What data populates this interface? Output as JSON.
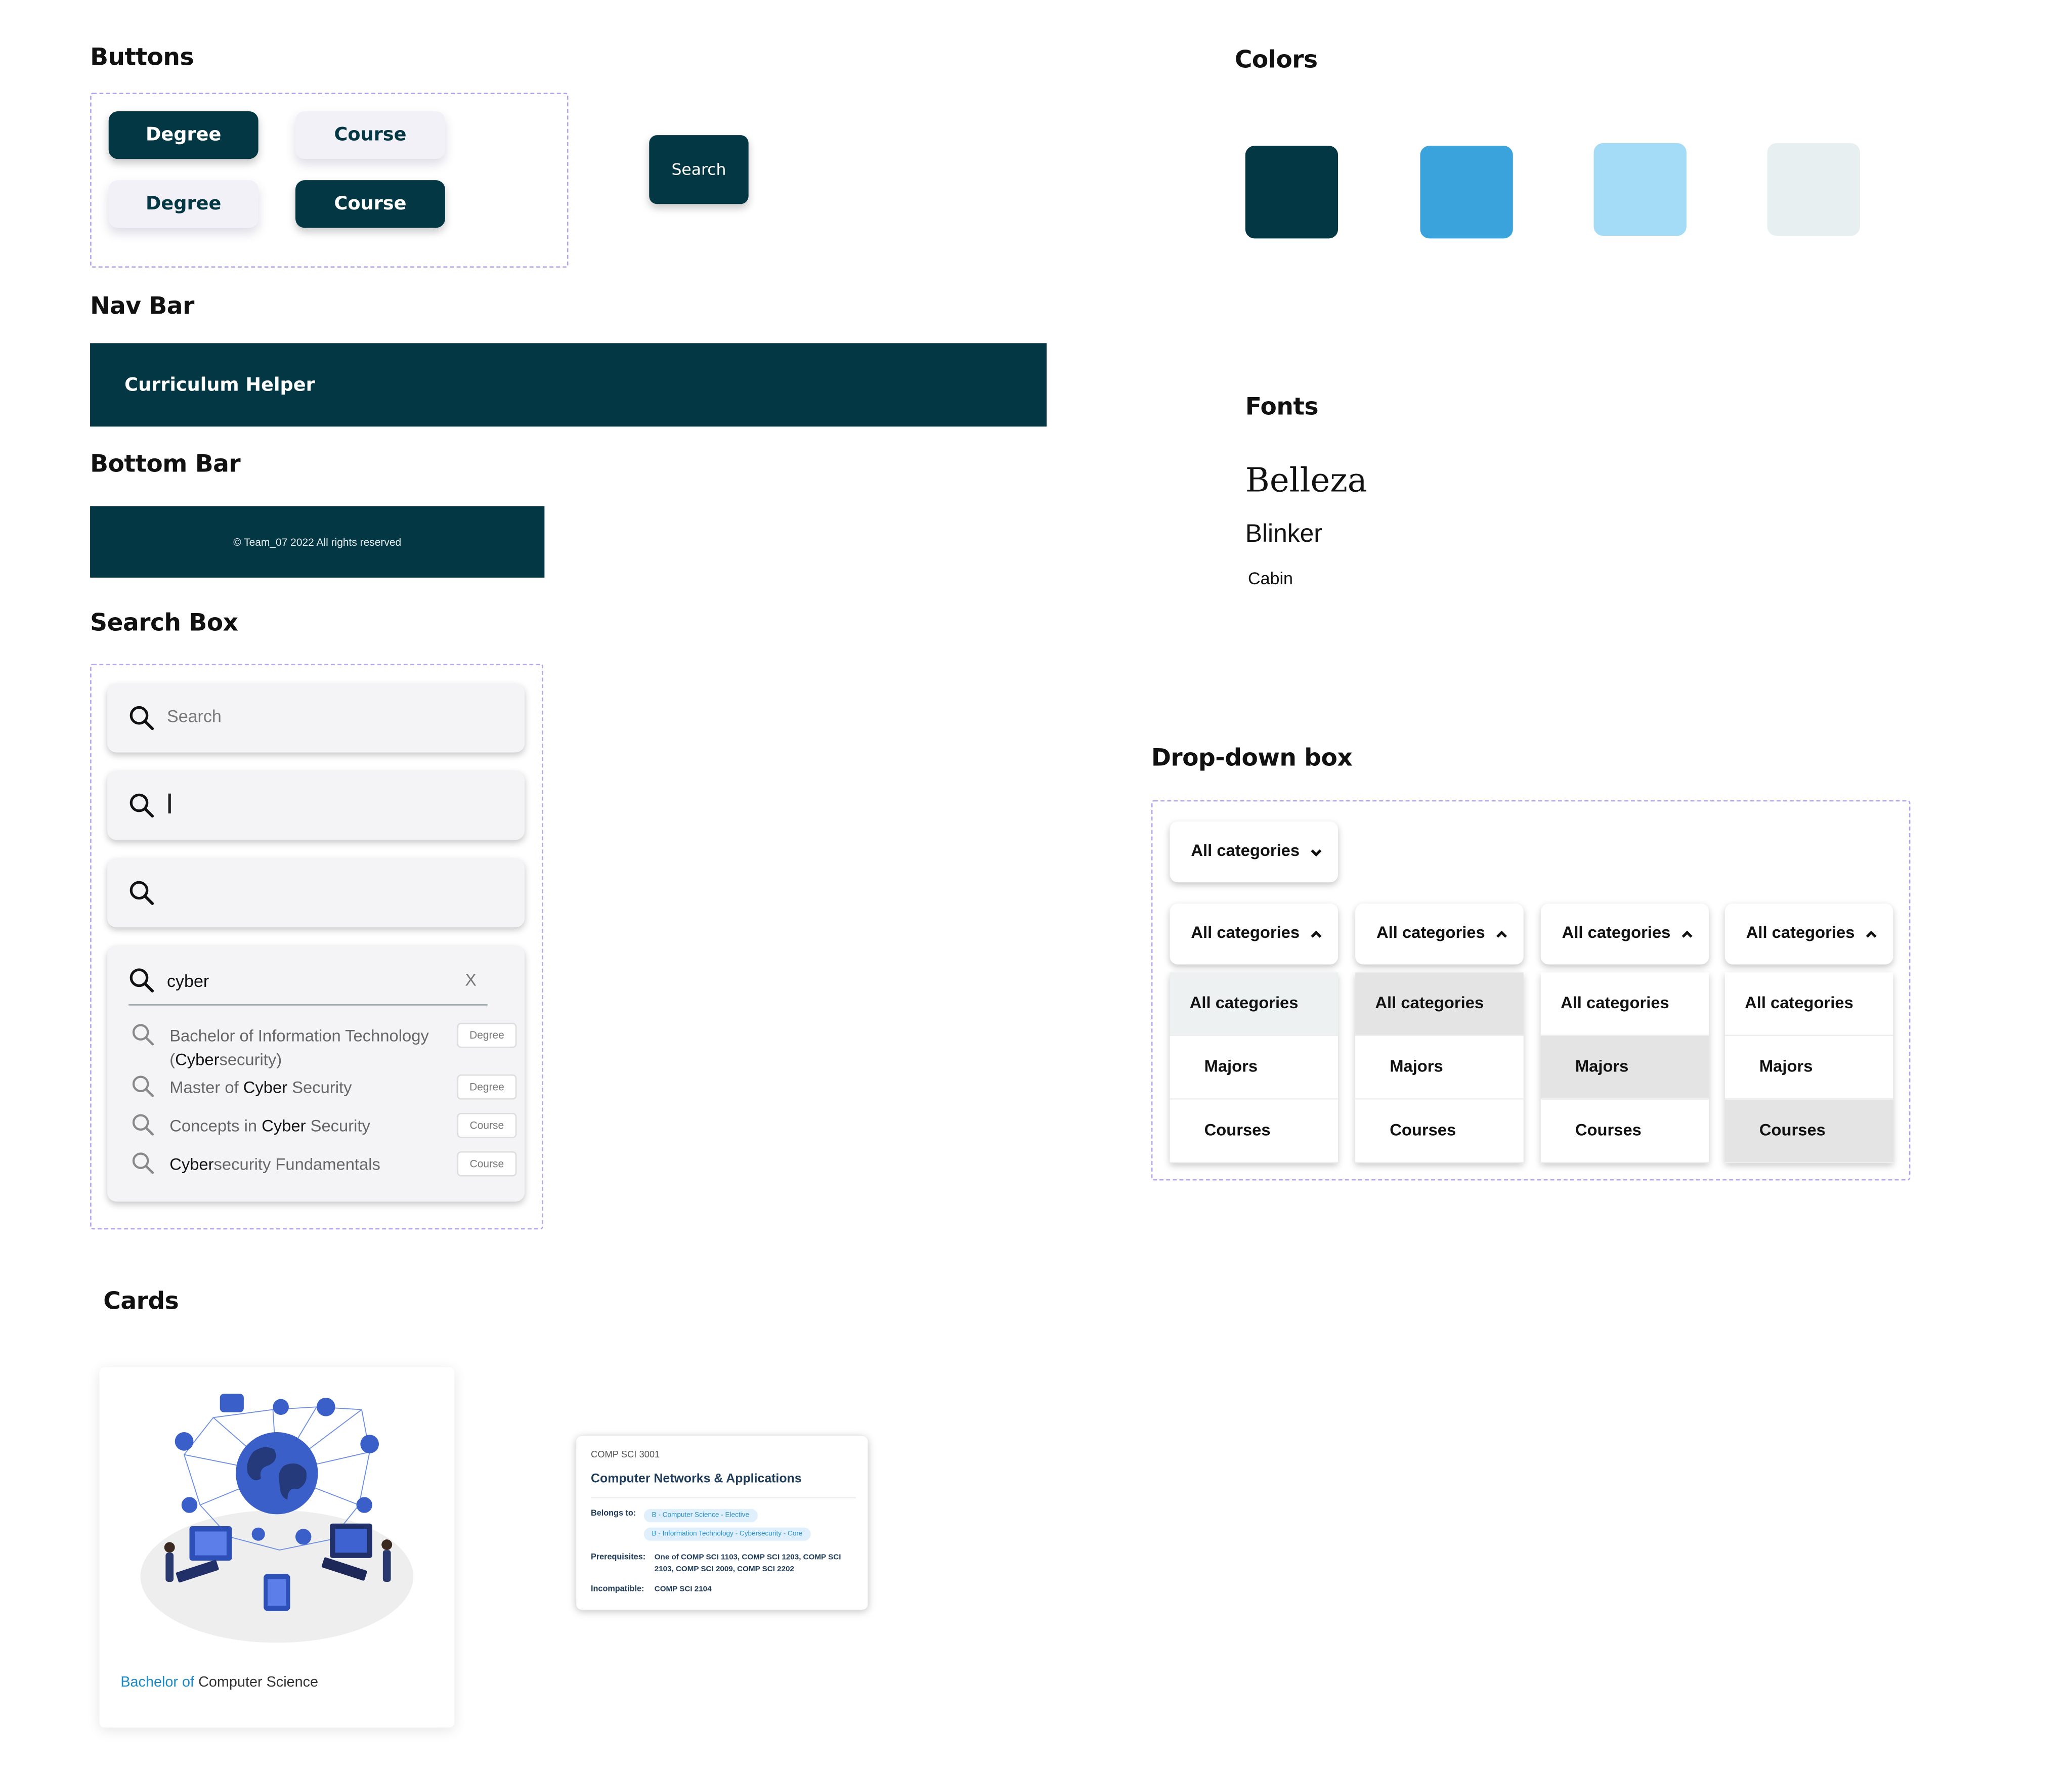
{
  "sections": {
    "buttons": "Buttons",
    "colors": "Colors",
    "nav_bar": "Nav Bar",
    "bottom_bar": "Bottom Bar",
    "fonts": "Fonts",
    "search_box": "Search Box",
    "dropdown": "Drop-down box",
    "cards": "Cards"
  },
  "buttons": {
    "degree_dark": "Degree",
    "course_light": "Course",
    "degree_light": "Degree",
    "course_dark": "Course",
    "search": "Search"
  },
  "colors": {
    "swatches": [
      "#043744",
      "#3aa3dc",
      "#a4dcf8",
      "#e8eff0"
    ]
  },
  "navbar": {
    "title": "Curriculum Helper"
  },
  "bottombar": {
    "text": "© Team_07  2022  All rights reserved"
  },
  "fonts": {
    "belleza": "Belleza",
    "blinker": "Blinker",
    "cabin": "Cabin"
  },
  "search": {
    "placeholder": "Search",
    "query": "cyber",
    "clear": "X",
    "results": [
      {
        "pre": "Bachelor of Information Technology (",
        "match": "Cyber",
        "post": "security)",
        "tag": "Degree"
      },
      {
        "pre": "Master of ",
        "match": "Cyber",
        "post": " Security",
        "tag": "Degree"
      },
      {
        "pre": "Concepts in ",
        "match": "Cyber",
        "post": " Security",
        "tag": "Course"
      },
      {
        "pre": "",
        "match": "Cyber",
        "post": "security Fundamentals",
        "tag": "Course"
      }
    ]
  },
  "dropdown": {
    "label": "All categories",
    "options": [
      "All categories",
      "Majors",
      "Courses"
    ]
  },
  "cards": {
    "degree_card": {
      "prefix": "Bachelor of",
      "name": " Computer Science"
    },
    "course_card": {
      "code": "COMP SCI 3001",
      "name": "Computer Networks & Applications",
      "belongs_label": "Belongs to:",
      "belongs": [
        "B - Computer Science - Elective",
        "B - Information Technology - Cybersecurity - Core"
      ],
      "prereq_label": "Prerequisites:",
      "prereq": "One of COMP SCI 1103, COMP SCI 1203, COMP SCI 2103, COMP SCI 2009, COMP SCI 2202",
      "incompat_label": "Incompatible:",
      "incompat": "COMP SCI 2104"
    }
  }
}
